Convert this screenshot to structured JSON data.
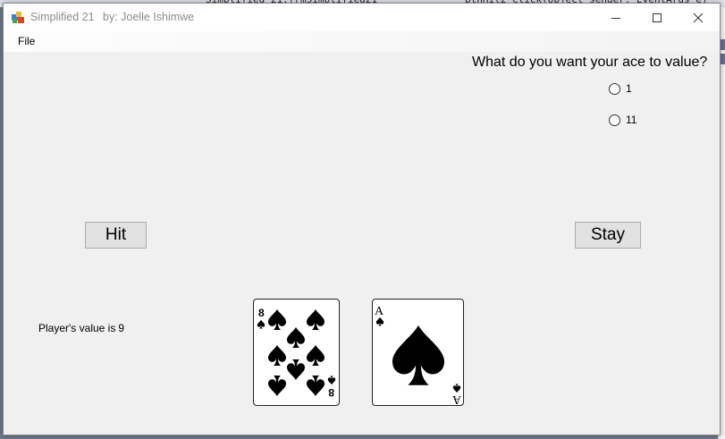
{
  "window": {
    "title": "Simplified 21",
    "author": "by: Joelle Ishimwe"
  },
  "menu": {
    "file_label": "File"
  },
  "ace_prompt": {
    "question": "What do you want your ace to value?",
    "options": [
      {
        "label": "1",
        "selected": false
      },
      {
        "label": "11",
        "selected": false
      }
    ]
  },
  "buttons": {
    "hit_label": "Hit",
    "stay_label": "Stay"
  },
  "player": {
    "label": "Player's value is",
    "value": "9"
  },
  "cards": [
    {
      "rank": "8",
      "suit": "spades"
    },
    {
      "rank": "A",
      "suit": "spades"
    }
  ],
  "icons": {
    "app": "app-icon",
    "minimize": "minimize-icon",
    "maximize": "maximize-icon",
    "close": "close-icon"
  }
}
